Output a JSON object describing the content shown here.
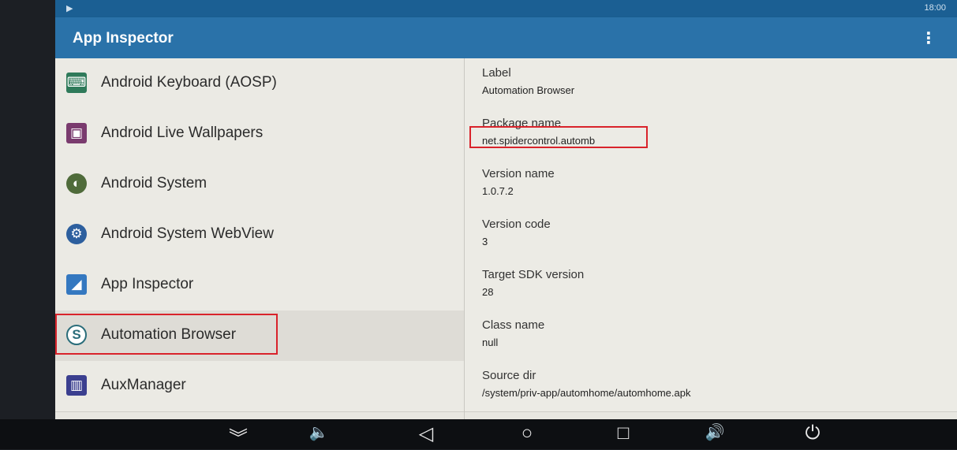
{
  "status": {
    "left_icon": "▶",
    "time": "18:00"
  },
  "appbar": {
    "title": "App Inspector",
    "menu_icon": "⋮"
  },
  "apps": [
    {
      "label": "Android Keyboard (AOSP)",
      "icon": "keyboard-icon",
      "glyph": "⌨",
      "color": "#2f7a5a"
    },
    {
      "label": "Android Live Wallpapers",
      "icon": "wallpaper-icon",
      "glyph": "▣",
      "color": "#7a3b6e"
    },
    {
      "label": "Android System",
      "icon": "android-system-icon",
      "glyph": "◐",
      "color": "#4f6b3a"
    },
    {
      "label": "Android System WebView",
      "icon": "gear-icon",
      "glyph": "⚙",
      "color": "#2d5f9e"
    },
    {
      "label": "App Inspector",
      "icon": "inspector-icon",
      "glyph": "◢",
      "color": "#3478c0"
    },
    {
      "label": "Automation Browser",
      "icon": "spider-logo-icon",
      "glyph": "S",
      "color": "#5b8f9a"
    },
    {
      "label": "AuxManager",
      "icon": "aux-manager-icon",
      "glyph": "▥",
      "color": "#3b3f8f"
    }
  ],
  "details": [
    {
      "key": "Label",
      "value": "Automation Browser"
    },
    {
      "key": "Package name",
      "value": "net.spidercontrol.automb"
    },
    {
      "key": "Version name",
      "value": "1.0.7.2"
    },
    {
      "key": "Version code",
      "value": "3"
    },
    {
      "key": "Target SDK version",
      "value": "28"
    },
    {
      "key": "Class name",
      "value": "null"
    },
    {
      "key": "Source dir",
      "value": "/system/priv-app/automhome/automhome.apk"
    }
  ],
  "nav": {
    "collapse": "︾",
    "vol_down": "🔈",
    "back": "◁",
    "home": "○",
    "recents": "□",
    "vol_up": "🔊",
    "power": "⏻"
  }
}
